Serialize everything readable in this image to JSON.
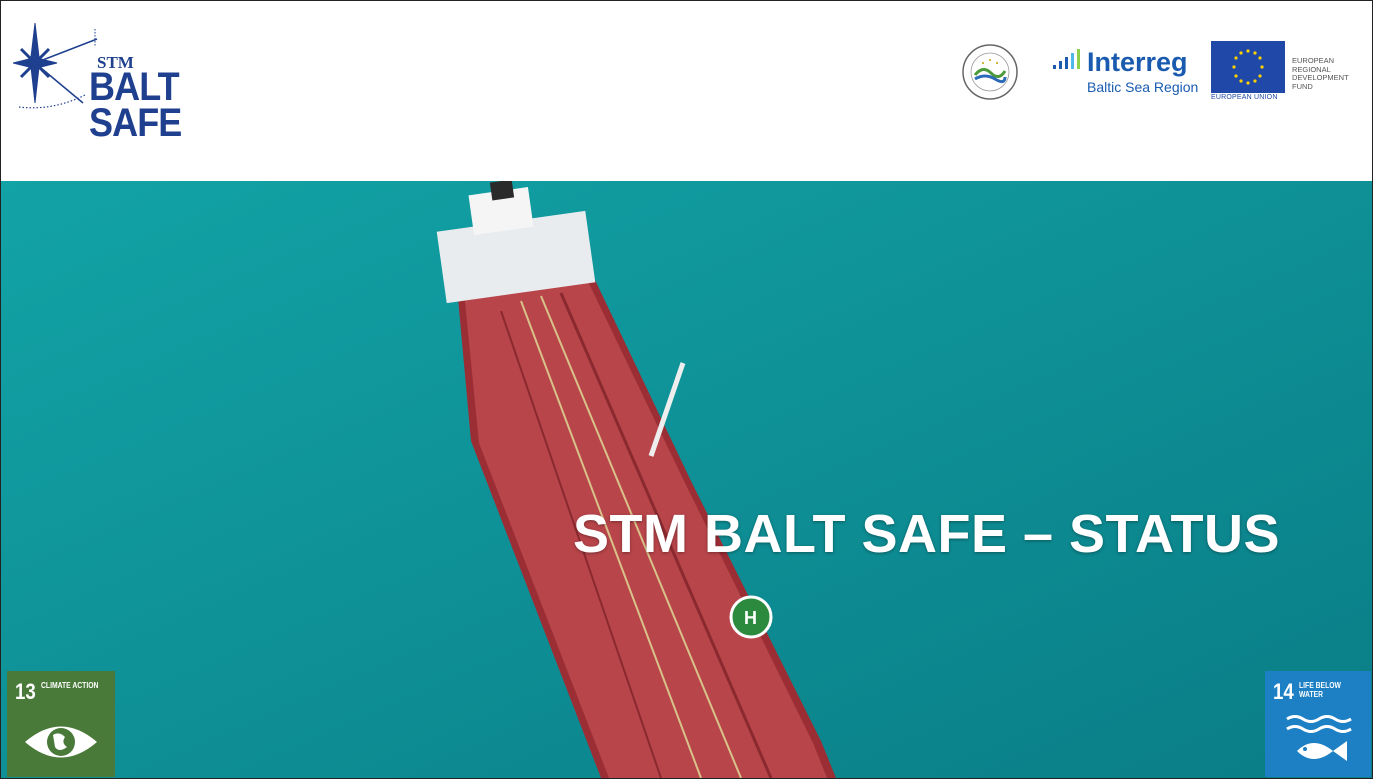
{
  "header": {
    "logo": {
      "small": "STM",
      "line1": "BALT",
      "line2": "SAFE"
    },
    "interreg": {
      "name": "Interreg",
      "sub": "Baltic Sea Region"
    },
    "eu": {
      "union": "EUROPEAN UNION",
      "fund_lines": "EUROPEAN REGIONAL DEVELOPMENT FUND"
    },
    "seal_icon": "flagship-seal-icon"
  },
  "hero": {
    "title": "STM BALT SAFE – STATUS",
    "background_color": "#0e8f95",
    "ship_icon": "tanker-ship-icon"
  },
  "sdg": {
    "left": {
      "number": "13",
      "label": "CLIMATE ACTION",
      "color": "#4a7a3a",
      "icon": "eye-globe-icon"
    },
    "right": {
      "number": "14",
      "label": "LIFE BELOW WATER",
      "color": "#1d7fc4",
      "icon": "fish-waves-icon"
    }
  },
  "colors": {
    "brand_blue": "#1f3f8f",
    "interreg_blue": "#1a5bb0",
    "eu_blue": "#1f48a8"
  }
}
